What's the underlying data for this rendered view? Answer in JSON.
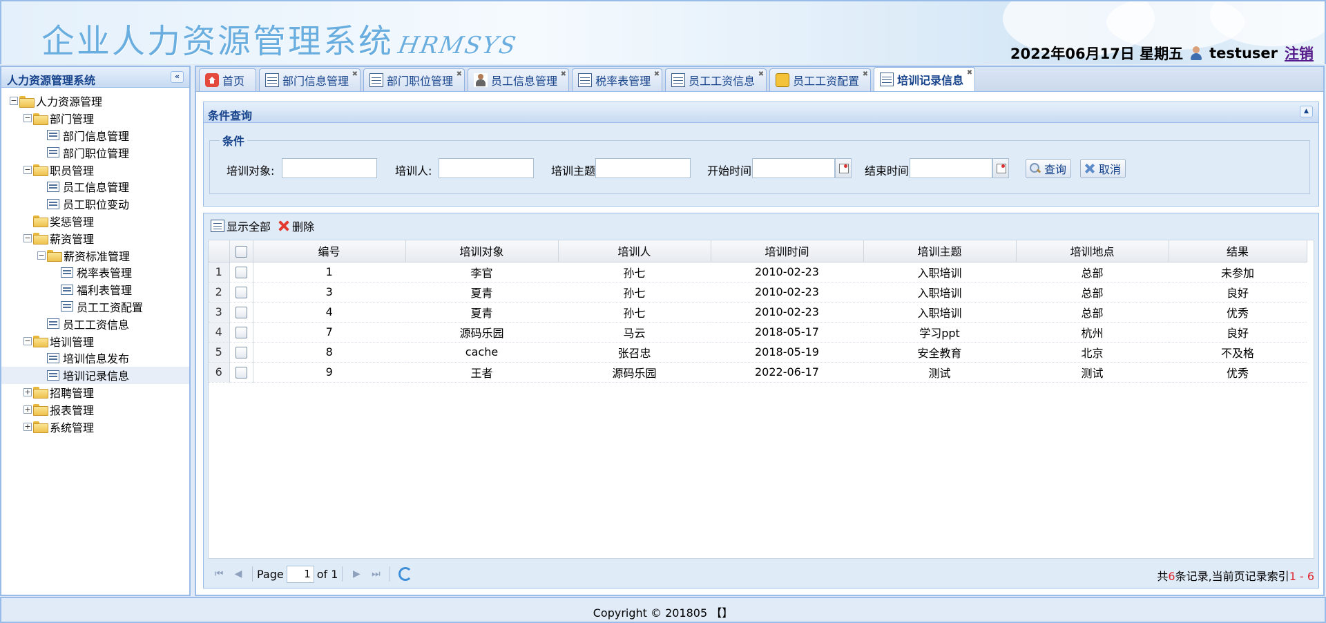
{
  "header": {
    "title": "企业人力资源管理系统",
    "subtitle": "HRMSYS",
    "date": "2022年06月17日 星期五",
    "username": "testuser",
    "logout_label": "注销"
  },
  "sidebar": {
    "title": "人力资源管理系统",
    "tree": [
      {
        "label": "人力资源管理",
        "level": 0,
        "type": "folder",
        "expander": "−"
      },
      {
        "label": "部门管理",
        "level": 1,
        "type": "folder",
        "expander": "−"
      },
      {
        "label": "部门信息管理",
        "level": 2,
        "type": "leaf"
      },
      {
        "label": "部门职位管理",
        "level": 2,
        "type": "leaf"
      },
      {
        "label": "职员管理",
        "level": 1,
        "type": "folder",
        "expander": "−"
      },
      {
        "label": "员工信息管理",
        "level": 2,
        "type": "leaf"
      },
      {
        "label": "员工职位变动",
        "level": 2,
        "type": "leaf"
      },
      {
        "label": "奖惩管理",
        "level": 1,
        "type": "folder"
      },
      {
        "label": "薪资管理",
        "level": 1,
        "type": "folder",
        "expander": "−"
      },
      {
        "label": "薪资标准管理",
        "level": 2,
        "type": "folder",
        "expander": "−"
      },
      {
        "label": "税率表管理",
        "level": 3,
        "type": "leaf"
      },
      {
        "label": "福利表管理",
        "level": 3,
        "type": "leaf"
      },
      {
        "label": "员工工资配置",
        "level": 3,
        "type": "leaf"
      },
      {
        "label": "员工工资信息",
        "level": 2,
        "type": "leaf"
      },
      {
        "label": "培训管理",
        "level": 1,
        "type": "folder",
        "expander": "−"
      },
      {
        "label": "培训信息发布",
        "level": 2,
        "type": "leaf"
      },
      {
        "label": "培训记录信息",
        "level": 2,
        "type": "leaf",
        "selected": true
      },
      {
        "label": "招聘管理",
        "level": 1,
        "type": "folder",
        "expander": "+"
      },
      {
        "label": "报表管理",
        "level": 1,
        "type": "folder",
        "expander": "+"
      },
      {
        "label": "系统管理",
        "level": 1,
        "type": "folder",
        "expander": "+"
      }
    ]
  },
  "tabs": [
    {
      "label": "首页",
      "icon": "home-icon",
      "closable": false
    },
    {
      "label": "部门信息管理",
      "icon": "monitor-icon",
      "closable": true
    },
    {
      "label": "部门职位管理",
      "icon": "grid-icon",
      "closable": true
    },
    {
      "label": "员工信息管理",
      "icon": "person-icon",
      "closable": true
    },
    {
      "label": "税率表管理",
      "icon": "list-icon",
      "closable": true
    },
    {
      "label": "员工工资信息",
      "icon": "table-icon",
      "closable": true
    },
    {
      "label": "员工工资配置",
      "icon": "wallet-icon",
      "closable": true
    },
    {
      "label": "培训记录信息",
      "icon": "list-icon",
      "closable": true,
      "active": true
    }
  ],
  "query": {
    "panel_title": "条件查询",
    "legend": "条件",
    "trainee_label": "培训对象:",
    "trainer_label": "培训人:",
    "topic_label": "培训主题:",
    "start_label": "开始时间:",
    "end_label": "结束时间:",
    "trainee_value": "",
    "trainer_value": "",
    "topic_value": "",
    "start_value": "",
    "end_value": "",
    "search_label": "查询",
    "cancel_label": "取消"
  },
  "toolbar": {
    "show_all_label": "显示全部",
    "delete_label": "删除"
  },
  "grid": {
    "columns": [
      "编号",
      "培训对象",
      "培训人",
      "培训时间",
      "培训主题",
      "培训地点",
      "结果"
    ],
    "rows": [
      {
        "num": "1",
        "cells": [
          "1",
          "李官",
          "孙七",
          "2010-02-23",
          "入职培训",
          "总部",
          "未参加"
        ]
      },
      {
        "num": "2",
        "cells": [
          "3",
          "夏青",
          "孙七",
          "2010-02-23",
          "入职培训",
          "总部",
          "良好"
        ]
      },
      {
        "num": "3",
        "cells": [
          "4",
          "夏青",
          "孙七",
          "2010-02-23",
          "入职培训",
          "总部",
          "优秀"
        ]
      },
      {
        "num": "4",
        "cells": [
          "7",
          "源码乐园",
          "马云",
          "2018-05-17",
          "学习ppt",
          "杭州",
          "良好"
        ]
      },
      {
        "num": "5",
        "cells": [
          "8",
          "cache",
          "张召忠",
          "2018-05-19",
          "安全教育",
          "北京",
          "不及格"
        ]
      },
      {
        "num": "6",
        "cells": [
          "9",
          "王者",
          "源码乐园",
          "2022-06-17",
          "测试",
          "测试",
          "优秀"
        ]
      }
    ]
  },
  "pager": {
    "page_label": "Page",
    "page_value": "1",
    "of_label": "of 1",
    "info_prefix": "共",
    "total": "6",
    "info_mid": "条记录,当前页记录索引",
    "range": "1 - 6"
  },
  "footer": {
    "copyright": "Copyright © 201805 【】"
  },
  "colors": {
    "accent": "#15428b",
    "border": "#99bbe8",
    "highlight": "#e0242b"
  }
}
